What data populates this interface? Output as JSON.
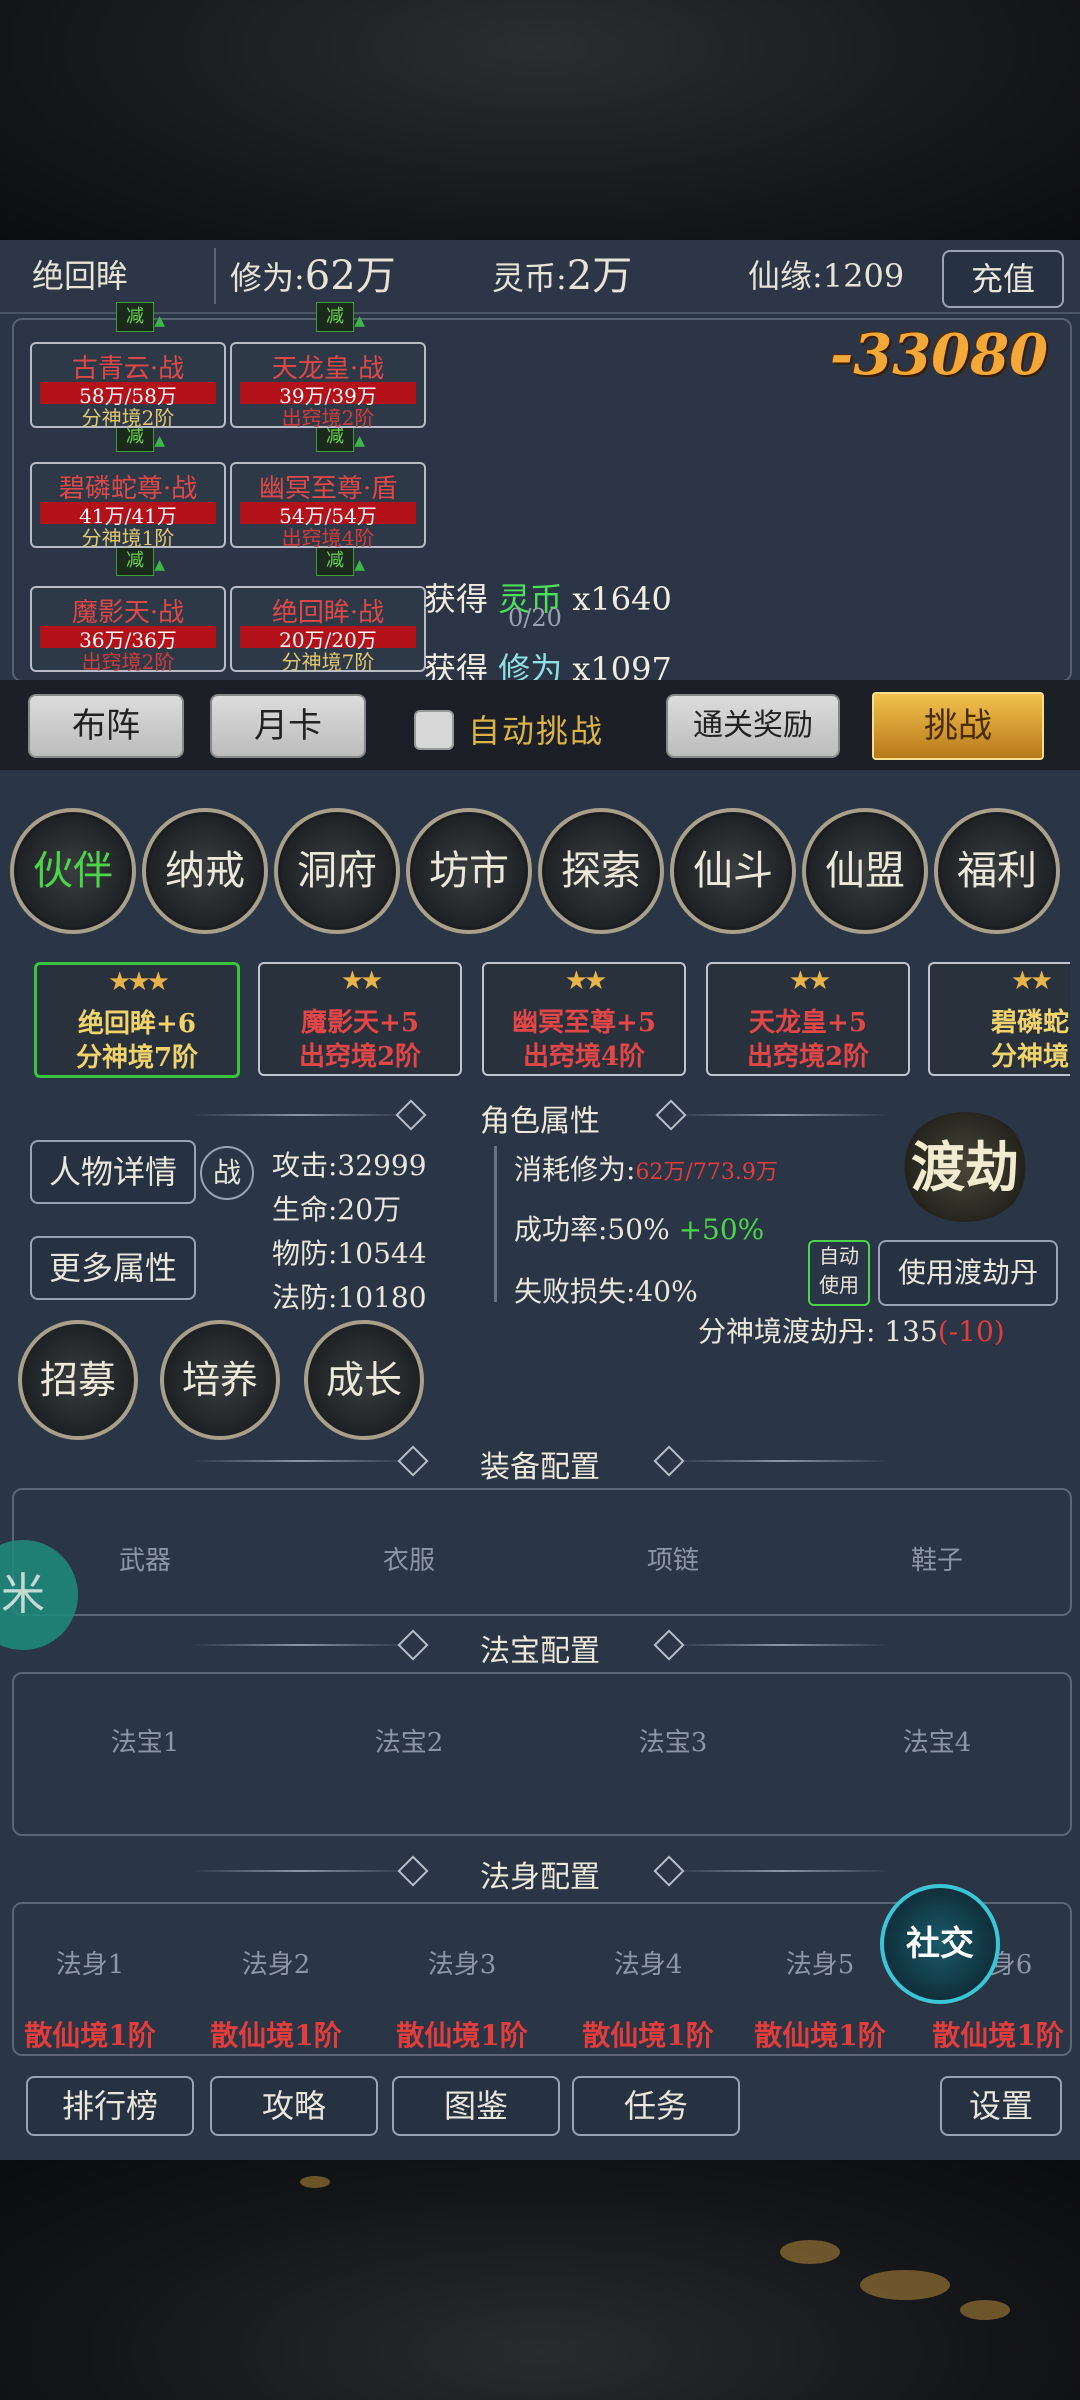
{
  "topbar": {
    "player_name": "绝回眸",
    "xiuwei_label": "修为:",
    "xiuwei_value": "62万",
    "lingbi_label": "灵币:",
    "lingbi_value": "2万",
    "xianyuan": "仙缘:1209",
    "recharge": "充值"
  },
  "battle": {
    "damage": "-33080",
    "minus_label": "减",
    "units": [
      {
        "name": "古青云·战",
        "hp": "58万/58万",
        "realm": "分神境2阶",
        "realm_color": "yellow"
      },
      {
        "name": "天龙皇·战",
        "hp": "39万/39万",
        "realm": "出窍境2阶",
        "realm_color": "red"
      },
      {
        "name": "碧磷蛇尊·战",
        "hp": "41万/41万",
        "realm": "分神境1阶",
        "realm_color": "yellow"
      },
      {
        "name": "幽冥至尊·盾",
        "hp": "54万/54万",
        "realm": "出窍境4阶",
        "realm_color": "red"
      },
      {
        "name": "魔影天·战",
        "hp": "36万/36万",
        "realm": "出窍境2阶",
        "realm_color": "red"
      },
      {
        "name": "绝回眸·战",
        "hp": "20万/20万",
        "realm": "分神境7阶",
        "realm_color": "yellow"
      }
    ],
    "gain1_prefix": "获得",
    "gain1_item": "灵币",
    "gain1_amount": "x1640",
    "gain2_prefix": "获得",
    "gain2_item": "修为",
    "gain2_amount": "x1097",
    "progress": "0/20"
  },
  "controls": {
    "formation": "布阵",
    "monthly_card": "月卡",
    "auto_challenge": "自动挑战",
    "clear_reward": "通关奖励",
    "challenge": "挑战"
  },
  "nav": [
    "伙伴",
    "纳戒",
    "洞府",
    "坊市",
    "探索",
    "仙斗",
    "仙盟",
    "福利"
  ],
  "companions": [
    {
      "stars": "★★★",
      "name": "绝回眸+6",
      "realm": "分神境7阶"
    },
    {
      "stars": "★★",
      "name": "魔影天+5",
      "realm": "出窍境2阶"
    },
    {
      "stars": "★★",
      "name": "幽冥至尊+5",
      "realm": "出窍境4阶"
    },
    {
      "stars": "★★",
      "name": "天龙皇+5",
      "realm": "出窍境2阶"
    },
    {
      "stars": "★★",
      "name": "碧磷蛇",
      "realm": "分神境"
    }
  ],
  "attributes": {
    "title": "角色属性",
    "details_btn": "人物详情",
    "battle_tag": "战",
    "more_btn": "更多属性",
    "attack": "攻击:32999",
    "life": "生命:20万",
    "phys_def": "物防:10544",
    "magic_def": "法防:10180",
    "cost_label": "消耗修为:",
    "cost_value": "62万/773.9万",
    "success_label": "成功率:50%",
    "success_bonus": "+50%",
    "fail_loss": "失败损失:40%",
    "dujie": "渡劫",
    "auto_use": "自动使用",
    "use_pill": "使用渡劫丹",
    "pill_label": "分神境渡劫丹:",
    "pill_count": "135",
    "pill_delta": "(-10)",
    "recruit": "招募",
    "train": "培养",
    "grow": "成长"
  },
  "equipment": {
    "title": "装备配置",
    "slots": [
      "武器",
      "衣服",
      "项链",
      "鞋子"
    ]
  },
  "treasures": {
    "title": "法宝配置",
    "slots": [
      "法宝1",
      "法宝2",
      "法宝3",
      "法宝4"
    ]
  },
  "bodies": {
    "title": "法身配置",
    "slots": [
      "法身1",
      "法身2",
      "法身3",
      "法身4",
      "法身5",
      "法身6"
    ],
    "realms": [
      "散仙境1阶",
      "散仙境1阶",
      "散仙境1阶",
      "散仙境1阶",
      "散仙境1阶",
      "散仙境1阶"
    ]
  },
  "side_badge": "米",
  "social": "社交",
  "bottom": {
    "ranking": "排行榜",
    "guide": "攻略",
    "atlas": "图鉴",
    "tasks": "任务",
    "settings": "设置"
  },
  "colors": {
    "panel": "#2a3545",
    "gold": "#f3c24e",
    "green": "#4bd64a",
    "red": "#e24646"
  }
}
